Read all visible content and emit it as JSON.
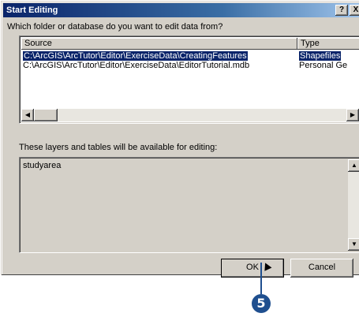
{
  "window": {
    "title": "Start Editing",
    "help_button": "?",
    "close_button": "X"
  },
  "source_prompt": "Which folder or database do you want to edit data from?",
  "source_list": {
    "columns": [
      "Source",
      "Type"
    ],
    "rows": [
      {
        "source": "C:\\ArcGIS\\ArcTutor\\Editor\\ExerciseData\\CreatingFeatures",
        "type": "Shapefiles",
        "selected": true
      },
      {
        "source": "C:\\ArcGIS\\ArcTutor\\Editor\\ExerciseData\\EditorTutorial.mdb",
        "type": "Personal Ge",
        "selected": false
      }
    ]
  },
  "layers_prompt": "These layers and tables will be available for editing:",
  "layers_list": {
    "items": [
      "studyarea"
    ]
  },
  "buttons": {
    "ok": "OK",
    "cancel": "Cancel"
  },
  "callout": {
    "number": "5",
    "color": "#1f4f8f"
  },
  "colors": {
    "title_bar": "#0a246a",
    "selection": "#0a246a",
    "dialog_bg": "#d4d0c8"
  }
}
